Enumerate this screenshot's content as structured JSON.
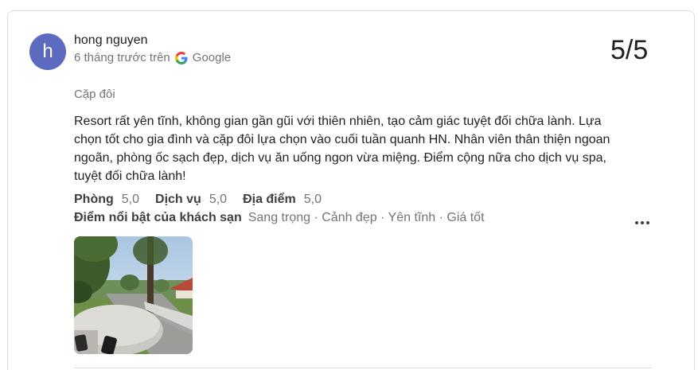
{
  "review": {
    "avatar_letter": "h",
    "avatar_color": "#5c6bc0",
    "reviewer_name": "hong nguyen",
    "time_ago": "6 tháng trước trên",
    "source": "Google",
    "rating": "5/5",
    "trip_type": "Cặp đôi",
    "text": "Resort rất yên tĩnh, không gian gần gũi với thiên nhiên, tạo cảm giác tuyệt đối chữa lành. Lựa chọn tốt cho gia đình và cặp đôi lựa chọn vào cuối tuần quanh HN. Nhân viên thân thiện ngoan ngoãn, phòng ốc sạch đẹp, dịch vụ ăn uống ngon vừa miệng. Điểm cộng nữa cho dịch vụ spa, tuyệt đối chữa lành!",
    "subratings": [
      {
        "label": "Phòng",
        "value": "5,0"
      },
      {
        "label": "Dịch vụ",
        "value": "5,0"
      },
      {
        "label": "Địa điểm",
        "value": "5,0"
      }
    ],
    "highlights_label": "Điểm nổi bật của khách sạn",
    "highlights": "Sang trọng · Cảnh đẹp · Yên tĩnh · Giá tốt",
    "more_icon": "more-horiz-icon",
    "photo_icon": "review-photo"
  }
}
